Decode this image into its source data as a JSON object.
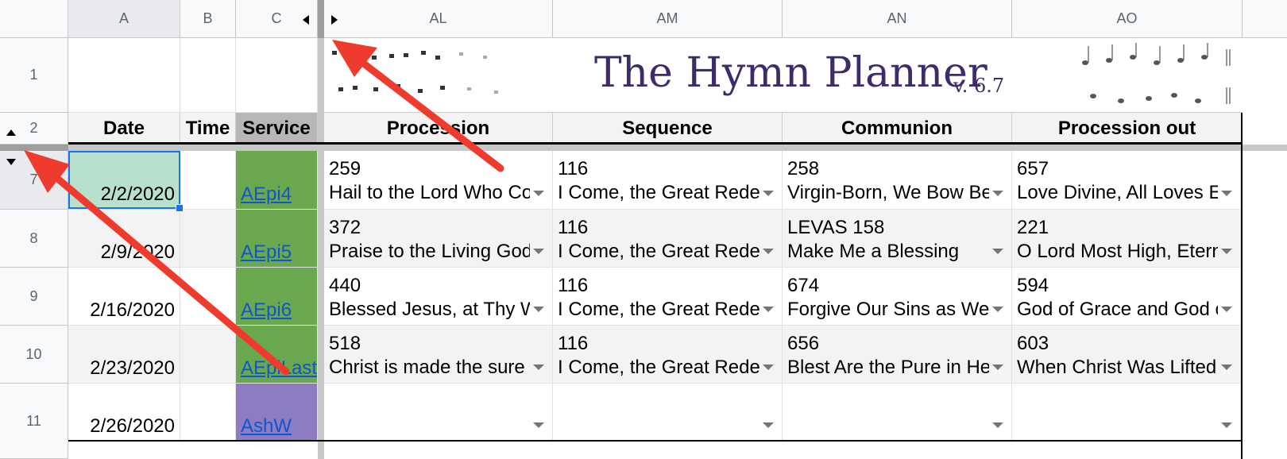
{
  "columns": {
    "row_corner": "",
    "A": "A",
    "B": "B",
    "C": "C",
    "AL": "AL",
    "AM": "AM",
    "AN": "AN",
    "AO": "AO"
  },
  "title_banner": {
    "title": "The Hymn Planner",
    "version": "v. 6.7"
  },
  "rows": {
    "r1": "1",
    "r2": "2",
    "r7": "7",
    "r8": "8",
    "r9": "9",
    "r10": "10",
    "r11": "11"
  },
  "headers": {
    "date": "Date",
    "time": "Time",
    "service": "Service",
    "procession": "Procession",
    "sequence": "Sequence",
    "communion": "Communion",
    "procession_out": "Procession out"
  },
  "data_rows": [
    {
      "date": "2/2/2020",
      "time": "",
      "service": "AEpi4",
      "service_color": "#6aa84f",
      "hymns": [
        {
          "num": "259",
          "title": "Hail to the Lord Who Comes"
        },
        {
          "num": "116",
          "title": "I Come, the Great Redeemer"
        },
        {
          "num": "258",
          "title": "Virgin-Born, We Bow Before Thee"
        },
        {
          "num": "657",
          "title": "Love Divine, All Loves Excelling"
        }
      ]
    },
    {
      "date": "2/9/2020",
      "time": "",
      "service": "AEpi5",
      "service_color": "#6aa84f",
      "hymns": [
        {
          "num": "372",
          "title": "Praise to the Living God"
        },
        {
          "num": "116",
          "title": "I Come, the Great Redeemer"
        },
        {
          "num": "LEVAS 158",
          "title": "Make Me a Blessing"
        },
        {
          "num": "221",
          "title": "O Lord Most High, Eternal King"
        }
      ]
    },
    {
      "date": "2/16/2020",
      "time": "",
      "service": "AEpi6",
      "service_color": "#6aa84f",
      "hymns": [
        {
          "num": "440",
          "title": "Blessed Jesus, at Thy Word"
        },
        {
          "num": "116",
          "title": "I Come, the Great Redeemer"
        },
        {
          "num": "674",
          "title": "Forgive Our Sins as We Forgive"
        },
        {
          "num": "594",
          "title": "God of Grace and God of Glory"
        }
      ]
    },
    {
      "date": "2/23/2020",
      "time": "",
      "service": "AEpiLast",
      "service_color": "#6aa84f",
      "hymns": [
        {
          "num": "518",
          "title": "Christ is made the sure foundation"
        },
        {
          "num": "116",
          "title": "I Come, the Great Redeemer"
        },
        {
          "num": "656",
          "title": "Blest Are the Pure in Heart"
        },
        {
          "num": "603",
          "title": "When Christ Was Lifted from the Earth"
        }
      ]
    },
    {
      "date": "2/26/2020",
      "time": "",
      "service": "AshW",
      "service_color": "#8e7cc3",
      "hymns": [
        {
          "num": "",
          "title": ""
        },
        {
          "num": "",
          "title": ""
        },
        {
          "num": "",
          "title": ""
        },
        {
          "num": "",
          "title": ""
        }
      ]
    }
  ],
  "colors": {
    "selected_fill": "#b7e1cd",
    "selection_border": "#1a73e8",
    "arrow": "#ef3b2d",
    "title": "#3d2b6b"
  }
}
